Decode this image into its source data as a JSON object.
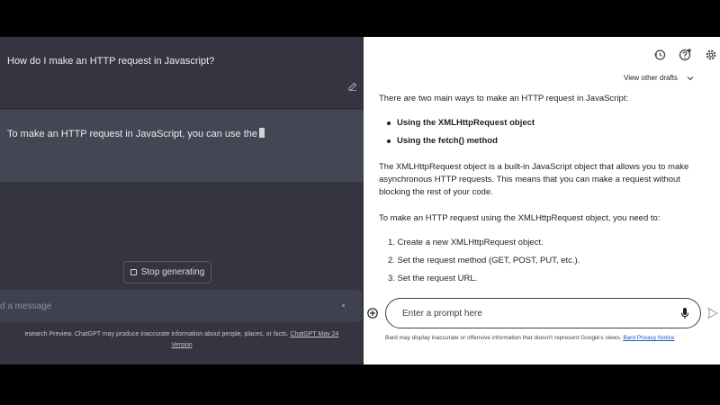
{
  "chatgpt": {
    "user_question": "How do I make an HTTP request in Javascript?",
    "assistant_partial": "To make an HTTP request in JavaScript, you can use the",
    "stop_button_label": "Stop generating",
    "message_placeholder": "d a message",
    "disclaimer_text": "esearch Preview. ChatGPT may produce inaccurate information about people, places, or facts.",
    "disclaimer_link": "ChatGPT May 24",
    "disclaimer_link_2": "Version"
  },
  "bard": {
    "view_drafts_label": "View other drafts",
    "intro": "There are two main ways to make an HTTP request in JavaScript:",
    "bullets": [
      "Using the XMLHttpRequest object",
      "Using the fetch() method"
    ],
    "para2": "The XMLHttpRequest object is a built-in JavaScript object that allows you to make asynchronous HTTP requests. This means that you can make a request without blocking the rest of your code.",
    "para3": "To make an HTTP request using the XMLHttpRequest object, you need to:",
    "steps": [
      "1. Create a new XMLHttpRequest object.",
      "2. Set the request method (GET, POST, PUT, etc.).",
      "3. Set the request URL."
    ],
    "prompt_placeholder": "Enter a prompt here",
    "disclaimer_text": "Bard may display inaccurate or offensive information that doesn't represent Google's views.",
    "disclaimer_link": "Bard Privacy Notice"
  },
  "icons": {
    "edit": "edit-icon",
    "stop": "stop-icon",
    "history": "history-icon",
    "help": "help-icon",
    "settings": "gear-icon",
    "chevron": "chevron-down-icon",
    "plus": "add-circle-icon",
    "mic": "mic-icon",
    "send": "send-icon"
  },
  "colors": {
    "chatgpt_bg": "#343541",
    "chatgpt_assistant_bg": "#444654",
    "bard_bg": "#ffffff"
  }
}
